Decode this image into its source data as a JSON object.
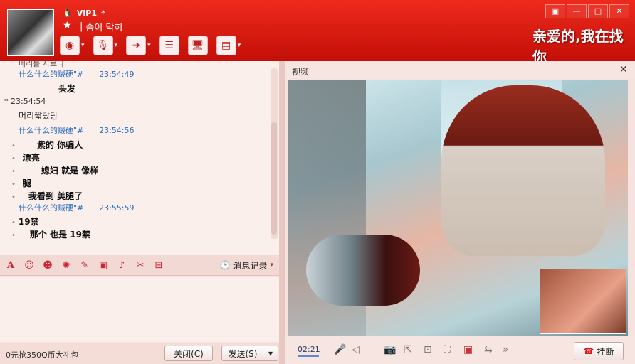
{
  "header": {
    "vip_label": "VIP1",
    "vip_mark": "*",
    "nickname": "숨이 막혀",
    "banner_text": "亲爱的,我在找你",
    "window_buttons": [
      "▣",
      "—",
      "□",
      "✕"
    ]
  },
  "toolbar": {
    "items": [
      {
        "icon": "video-icon"
      },
      {
        "icon": "voice-icon"
      },
      {
        "icon": "file-transfer-icon"
      },
      {
        "icon": "message-board-icon"
      },
      {
        "icon": "remote-assist-icon"
      },
      {
        "icon": "app-icon"
      }
    ]
  },
  "chat": {
    "lines": [
      {
        "kind": "bold",
        "text": "头发"
      },
      {
        "kind": "meta",
        "text": "* 23:54:54"
      },
      {
        "kind": "text",
        "text": "머리짧랐당"
      },
      {
        "kind": "sender",
        "sender": "什么什么的贼硬\"#",
        "time": "23:54:56"
      },
      {
        "kind": "bold",
        "text": "紫的    你骗人"
      },
      {
        "kind": "bold",
        "text": "漂亮"
      },
      {
        "kind": "bold",
        "text": "媳妇    就是  像样"
      },
      {
        "kind": "bold",
        "text": "腿"
      },
      {
        "kind": "bold",
        "text": "我看到      美腿了"
      },
      {
        "kind": "sender",
        "sender": "什么什么的贼硬\"#",
        "time": "23:55:59"
      },
      {
        "kind": "bold",
        "text": "19禁"
      },
      {
        "kind": "bold",
        "text": "那个  也是  19禁"
      }
    ],
    "first_sender": {
      "sender": "什么什么的贼硬\"#",
      "time": "23:54:49"
    },
    "cut_text": "머리를 자르다"
  },
  "chat_tools": {
    "icons": [
      "font-icon",
      "emoji-icon",
      "face-icon",
      "magic-face-icon",
      "edit-icon",
      "image-icon",
      "music-icon",
      "scissors-icon",
      "gift-icon"
    ],
    "history_label": "消息记录"
  },
  "bottom": {
    "promo": "0元抢350Q币大礼包",
    "close_label": "关闭(C)",
    "send_label": "发送(S)"
  },
  "video": {
    "title": "视频",
    "time": "02:21",
    "hangup_label": "挂断"
  },
  "colors": {
    "accent": "#d8180f",
    "link": "#2d6fbf"
  }
}
